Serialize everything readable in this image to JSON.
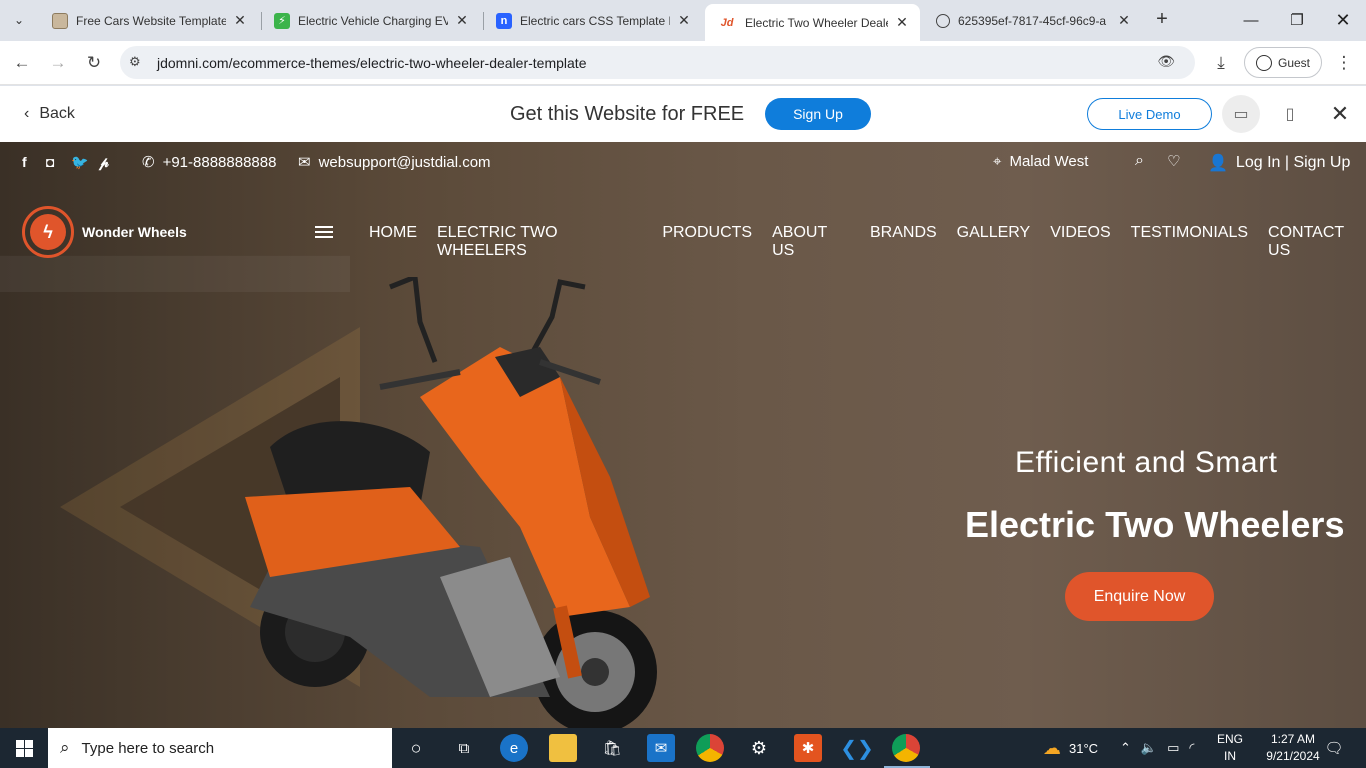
{
  "browser": {
    "tabs": [
      {
        "title": "Free Cars Website Templates",
        "favicon": "car-template-icon",
        "active": false
      },
      {
        "title": "Electric Vehicle Charging EV",
        "favicon": "ev-charging-icon",
        "active": false
      },
      {
        "title": "Electric cars CSS Template Li",
        "favicon": "n-letter-icon",
        "active": false
      },
      {
        "title": "Electric Two Wheeler Dealer",
        "favicon": "jd-icon",
        "active": true
      },
      {
        "title": "625395ef-7817-45cf-96c9-a",
        "favicon": "globe-icon",
        "active": false
      }
    ],
    "favicon_text_jd": "Jd",
    "favicon_text_n": "n",
    "url": "jdomni.com/ecommerce-themes/electric-two-wheeler-dealer-template",
    "profile_label": "Guest"
  },
  "jd_bar": {
    "back_label": "Back",
    "promo_text": "Get this Website for FREE",
    "signup_label": "Sign Up",
    "live_demo_label": "Live Demo"
  },
  "site": {
    "phone": "+91-8888888888",
    "email": "websupport@justdial.com",
    "location": "Malad West",
    "login_label": "Log In | Sign Up",
    "brand_name": "Wonder Wheels",
    "menu": [
      "HOME",
      "ELECTRIC TWO WHEELERS",
      "PRODUCTS",
      "ABOUT US",
      "BRANDS",
      "GALLERY",
      "VIDEOS",
      "TESTIMONIALS",
      "CONTACT US"
    ],
    "hero_subtitle": "Efficient and Smart",
    "hero_title": "Electric Two Wheelers",
    "hero_button": "Enquire Now",
    "accent_color": "#e0552b"
  },
  "taskbar": {
    "search_placeholder": "Type here to search",
    "weather": "31°C",
    "language_top": "ENG",
    "language_bottom": "IN",
    "time": "1:27 AM",
    "date": "9/21/2024"
  }
}
